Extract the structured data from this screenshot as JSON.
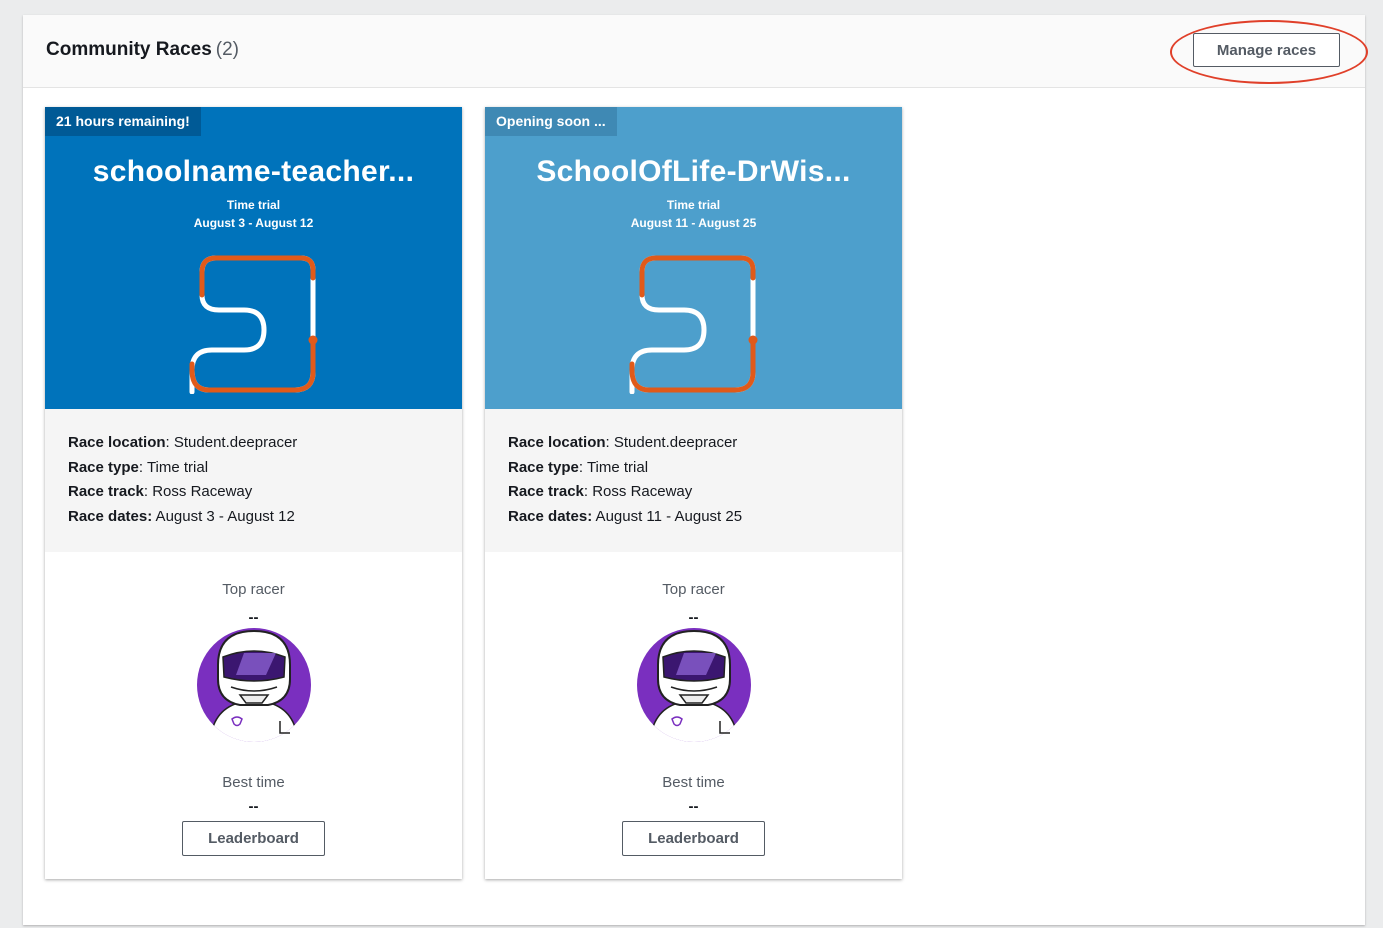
{
  "header": {
    "title": "Community Races",
    "count": "(2)",
    "manage_label": "Manage races"
  },
  "colors": {
    "card1_hero": "#0073bb",
    "card1_badge": "#005a96",
    "card2_hero": "#4d9fcc",
    "card2_badge": "#3f89b4",
    "track_orange": "#e05a1a",
    "avatar_purple": "#7a2fbf"
  },
  "cards": [
    {
      "badge": "21 hours remaining!",
      "name": "schoolname-teacher...",
      "type_small": "Time trial",
      "dates_small": "August 3 - August 12",
      "location_label": "Race location",
      "location_value": ": Student.deepracer",
      "type_label": "Race type",
      "type_value": ": Time trial",
      "track_label": "Race track",
      "track_value": ": Ross Raceway",
      "dates_label": "Race dates:",
      "dates_value": " August 3 - August 12",
      "top_racer_label": "Top racer",
      "top_racer_value": "--",
      "best_time_label": "Best time",
      "best_time_value": "--",
      "leaderboard_label": "Leaderboard"
    },
    {
      "badge": "Opening soon ...",
      "name": "SchoolOfLife-DrWis...",
      "type_small": "Time trial",
      "dates_small": "August 11 - August 25",
      "location_label": "Race location",
      "location_value": ": Student.deepracer",
      "type_label": "Race type",
      "type_value": ": Time trial",
      "track_label": "Race track",
      "track_value": ": Ross Raceway",
      "dates_label": "Race dates:",
      "dates_value": " August 11 - August 25",
      "top_racer_label": "Top racer",
      "top_racer_value": "--",
      "best_time_label": "Best time",
      "best_time_value": "--",
      "leaderboard_label": "Leaderboard"
    }
  ]
}
